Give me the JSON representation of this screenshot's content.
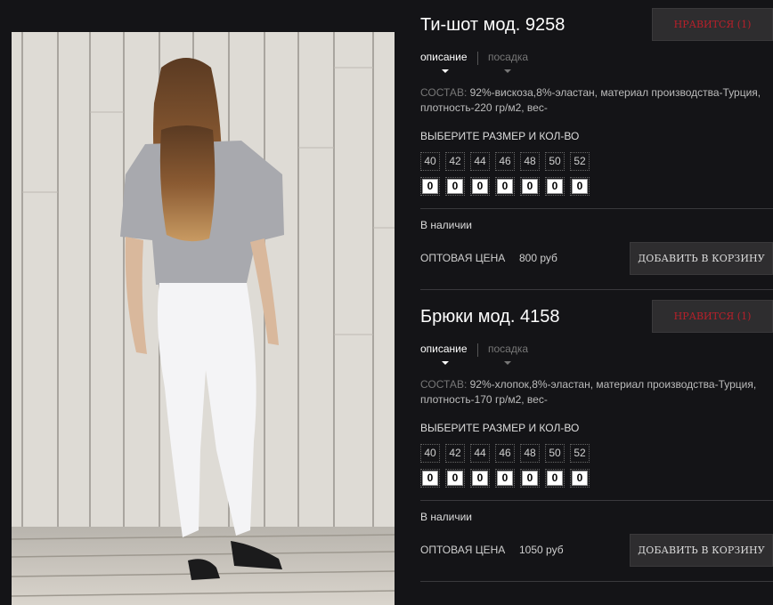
{
  "products": [
    {
      "title": "Ти-шот мод. 9258",
      "like_label": "НРАВИТСЯ (1)",
      "tabs": [
        "описание",
        "посадка"
      ],
      "composition_label": "СОСТАВ:",
      "composition_text": " 92%-вискоза,8%-эластан, материал производства-Турция, плотность-220 гр/м2, вес-",
      "size_title": "ВЫБЕРИТЕ РАЗМЕР И КОЛ-ВО",
      "sizes": [
        "40",
        "42",
        "44",
        "46",
        "48",
        "50",
        "52"
      ],
      "quantities": [
        "0",
        "0",
        "0",
        "0",
        "0",
        "0",
        "0"
      ],
      "stock": "В наличии",
      "price_label": "ОПТОВАЯ ЦЕНА",
      "price": "800 руб",
      "cart_label": "ДОБАВИТЬ В КОРЗИНУ"
    },
    {
      "title": "Брюки мод. 4158",
      "like_label": "НРАВИТСЯ (1)",
      "tabs": [
        "описание",
        "посадка"
      ],
      "composition_label": "СОСТАВ:",
      "composition_text": " 92%-хлопок,8%-эластан, материал производства-Турция, плотность-170 гр/м2, вес-",
      "size_title": "ВЫБЕРИТЕ РАЗМЕР И КОЛ-ВО",
      "sizes": [
        "40",
        "42",
        "44",
        "46",
        "48",
        "50",
        "52"
      ],
      "quantities": [
        "0",
        "0",
        "0",
        "0",
        "0",
        "0",
        "0"
      ],
      "stock": "В наличии",
      "price_label": "ОПТОВАЯ ЦЕНА",
      "price": "1050 руб",
      "cart_label": "ДОБАВИТЬ В КОРЗИНУ"
    }
  ],
  "colors": {
    "background": "#141417",
    "like_text": "#b8202a",
    "button_bg": "#2e2d2f"
  }
}
